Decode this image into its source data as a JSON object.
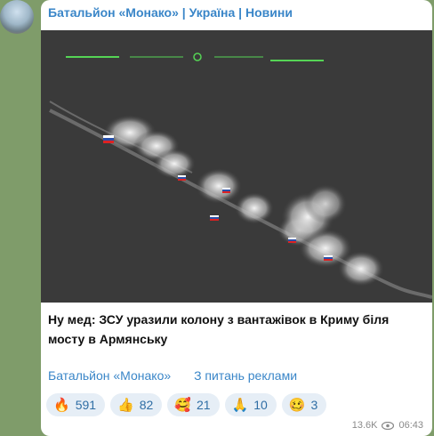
{
  "channel": {
    "name": "Батальйон «Монако» | Україна | Новини"
  },
  "post": {
    "caption": "Ну мед: ЗСУ уразили колону з вантажівок в Криму біля мосту в Армянську",
    "links": [
      "Батальйон «Монако»",
      "З питань реклами"
    ],
    "reactions": [
      {
        "emoji": "🔥",
        "count": "591"
      },
      {
        "emoji": "👍",
        "count": "82"
      },
      {
        "emoji": "🥰",
        "count": "21"
      },
      {
        "emoji": "🙏",
        "count": "10"
      },
      {
        "emoji": "🥴",
        "count": "3"
      }
    ],
    "views": "13.6K",
    "time": "06:43"
  },
  "colors": {
    "accent": "#3a86c8",
    "chat_background": "#7f9c6a",
    "reaction_bg": "#e6eef6"
  }
}
